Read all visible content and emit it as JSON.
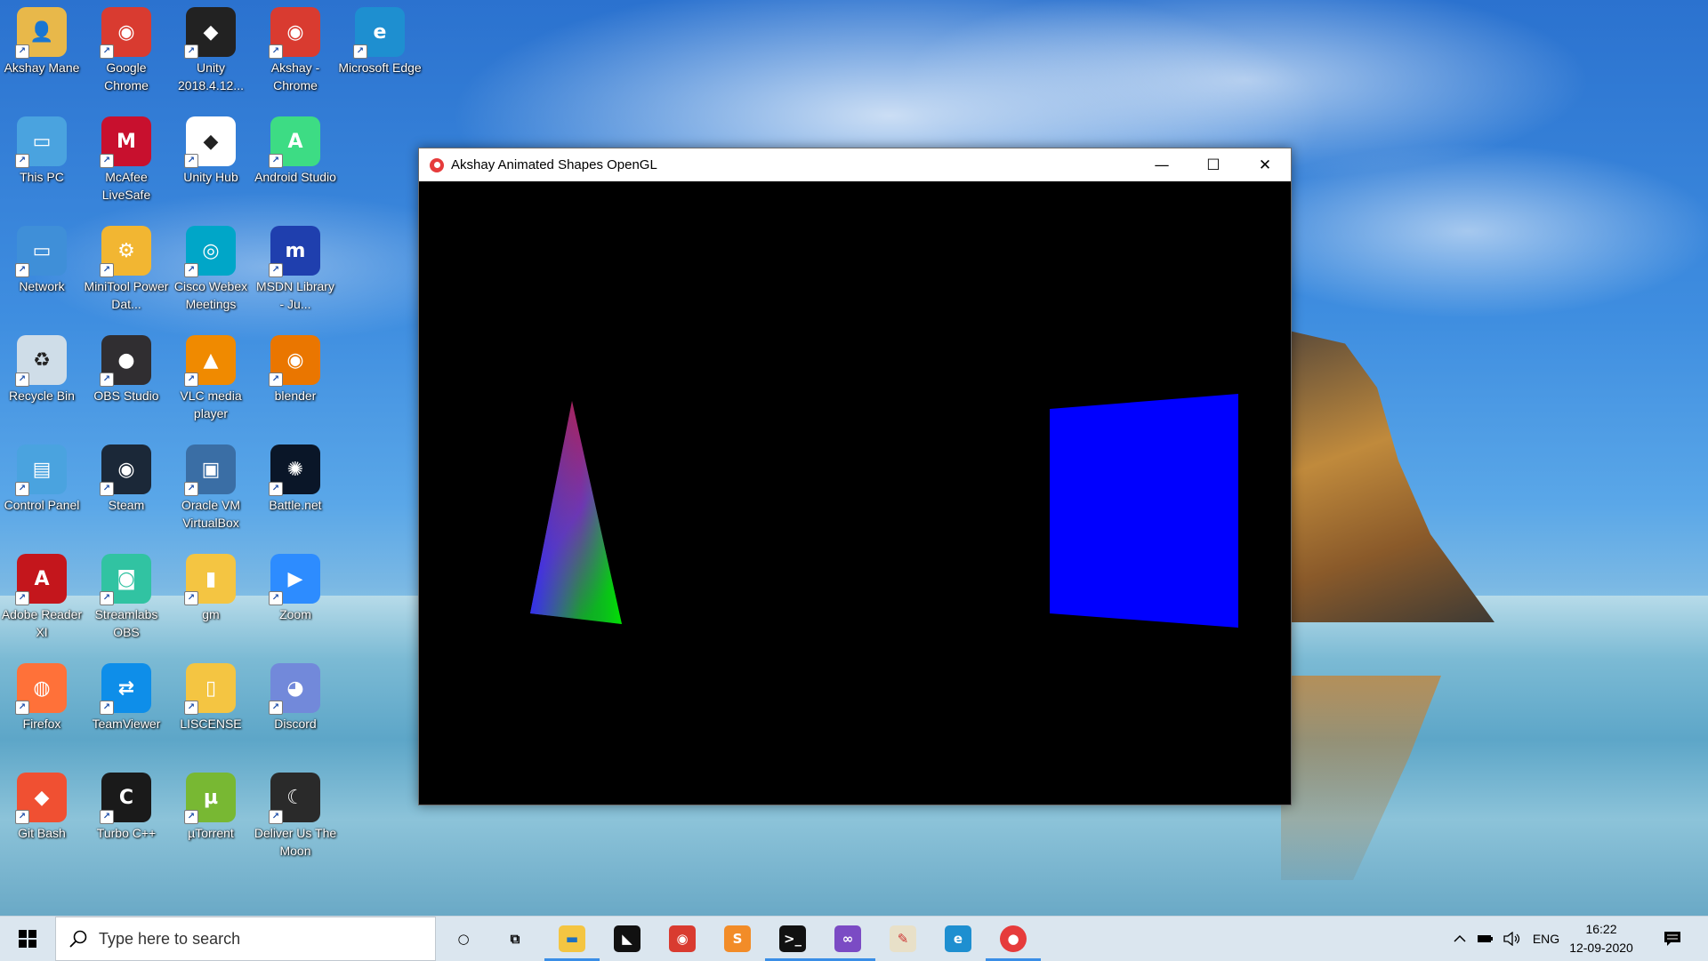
{
  "desktop_icons": [
    {
      "label": "Akshay Mane",
      "icon": "user-folder-icon",
      "color": "#e8b84a"
    },
    {
      "label": "Google Chrome",
      "icon": "chrome-icon",
      "color": "#d93b30"
    },
    {
      "label": "Unity 2018.4.12...",
      "icon": "unity-icon",
      "color": "#222222"
    },
    {
      "label": "Akshay - Chrome",
      "icon": "chrome-profile-icon",
      "color": "#d93b30"
    },
    {
      "label": "Microsoft Edge",
      "icon": "edge-icon",
      "color": "#1e8fd0"
    },
    {
      "label": "This PC",
      "icon": "computer-icon",
      "color": "#4aa3df"
    },
    {
      "label": "McAfee LiveSafe",
      "icon": "mcafee-icon",
      "color": "#c8102e"
    },
    {
      "label": "Unity Hub",
      "icon": "unity-hub-icon",
      "color": "#ffffff"
    },
    {
      "label": "Android Studio",
      "icon": "android-studio-icon",
      "color": "#3ddc84"
    },
    {
      "label": "Network",
      "icon": "network-icon",
      "color": "#3f8fd8"
    },
    {
      "label": "MiniTool Power Dat...",
      "icon": "minitool-icon",
      "color": "#f2b632"
    },
    {
      "label": "Cisco Webex Meetings",
      "icon": "webex-icon",
      "color": "#00a6c8"
    },
    {
      "label": "MSDN Library - Ju...",
      "icon": "msdn-icon",
      "color": "#1f3fae"
    },
    {
      "label": "Recycle Bin",
      "icon": "recycle-bin-icon",
      "color": "#cfdde8"
    },
    {
      "label": "OBS Studio",
      "icon": "obs-icon",
      "color": "#302e31"
    },
    {
      "label": "VLC media player",
      "icon": "vlc-icon",
      "color": "#f08a00"
    },
    {
      "label": "blender",
      "icon": "blender-icon",
      "color": "#ea7600"
    },
    {
      "label": "Control Panel",
      "icon": "control-panel-icon",
      "color": "#4aa3df"
    },
    {
      "label": "Steam",
      "icon": "steam-icon",
      "color": "#1b2838"
    },
    {
      "label": "Oracle VM VirtualBox",
      "icon": "virtualbox-icon",
      "color": "#3a6ea5"
    },
    {
      "label": "Battle.net",
      "icon": "battlenet-icon",
      "color": "#0a1628"
    },
    {
      "label": "Adobe Reader XI",
      "icon": "adobe-reader-icon",
      "color": "#c4161c"
    },
    {
      "label": "Streamlabs OBS",
      "icon": "streamlabs-icon",
      "color": "#31c3a2"
    },
    {
      "label": "gm",
      "icon": "folder-icon",
      "color": "#f4c542"
    },
    {
      "label": "Zoom",
      "icon": "zoom-icon",
      "color": "#2d8cff"
    },
    {
      "label": "Firefox",
      "icon": "firefox-icon",
      "color": "#ff7139"
    },
    {
      "label": "TeamViewer",
      "icon": "teamviewer-icon",
      "color": "#0e8ee9"
    },
    {
      "label": "LISCENSE",
      "icon": "document-icon",
      "color": "#f4c542"
    },
    {
      "label": "Discord",
      "icon": "discord-icon",
      "color": "#7289da"
    },
    {
      "label": "Git Bash",
      "icon": "git-bash-icon",
      "color": "#f05032"
    },
    {
      "label": "Turbo C++",
      "icon": "turbo-cpp-icon",
      "color": "#1a1a1a"
    },
    {
      "label": "µTorrent",
      "icon": "utorrent-icon",
      "color": "#78b833"
    },
    {
      "label": "Deliver Us The Moon",
      "icon": "game-icon",
      "color": "#2a2a2a"
    }
  ],
  "window": {
    "title": "Akshay Animated Shapes OpenGL",
    "minimize": "—",
    "maximize": "☐",
    "close": "✕",
    "canvas_bg": "#000000",
    "square_color": "#0000ff",
    "triangle_colors": [
      "#ff0000",
      "#00ff00",
      "#0000ff"
    ]
  },
  "taskbar": {
    "search_placeholder": "Type here to search",
    "apps": [
      {
        "icon": "cortana-icon",
        "active": false
      },
      {
        "icon": "task-view-icon",
        "active": false
      },
      {
        "icon": "file-explorer-icon",
        "active": true
      },
      {
        "icon": "predator-icon",
        "active": false
      },
      {
        "icon": "chrome-icon",
        "active": false
      },
      {
        "icon": "sublime-text-icon",
        "active": false
      },
      {
        "icon": "terminal-icon",
        "active": true
      },
      {
        "icon": "visual-studio-icon",
        "active": true
      },
      {
        "icon": "paint-icon",
        "active": false
      },
      {
        "icon": "edge-icon",
        "active": false
      },
      {
        "icon": "opengl-app-icon",
        "active": true
      }
    ],
    "tray_lang": "ENG",
    "time": "16:22",
    "date": "12-09-2020"
  }
}
